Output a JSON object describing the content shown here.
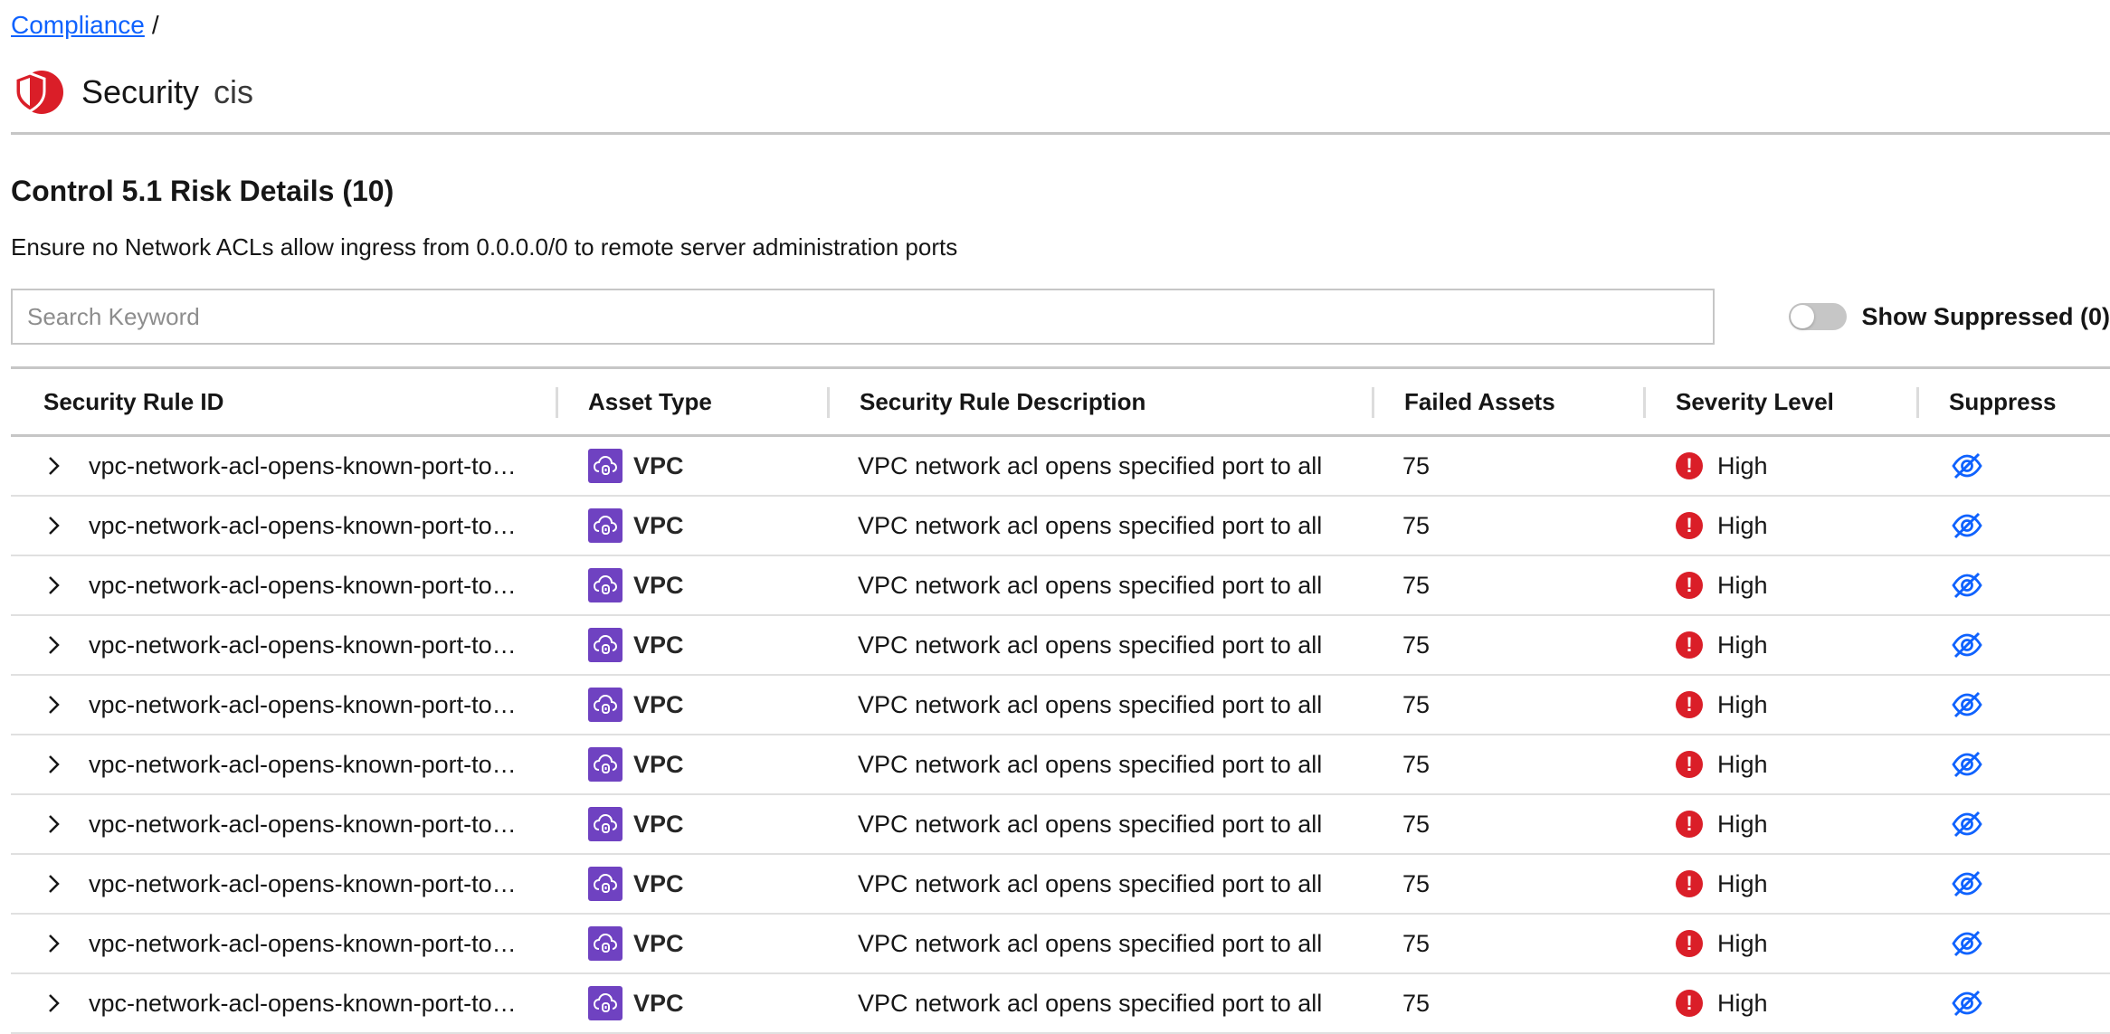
{
  "breadcrumb": {
    "link_label": "Compliance",
    "separator": "/"
  },
  "header": {
    "icon": "shield-icon",
    "title": "Security",
    "subtitle": "cis"
  },
  "section": {
    "title": "Control 5.1 Risk Details (10)",
    "description": "Ensure no Network ACLs allow ingress from 0.0.0.0/0 to remote server administration ports"
  },
  "search": {
    "placeholder": "Search Keyword",
    "value": ""
  },
  "toggle": {
    "label": "Show Suppressed (0)",
    "on": false
  },
  "colors": {
    "link": "#0f62fe",
    "brand_red": "#da1e28",
    "asset_purple": "#6f42c1",
    "suppress_blue": "#0f62fe"
  },
  "table": {
    "columns": [
      "Security Rule ID",
      "Asset Type",
      "Security Rule Description",
      "Failed Assets",
      "Severity Level",
      "Suppress"
    ],
    "rows": [
      {
        "rule_id": "vpc-network-acl-opens-known-port-to…",
        "asset_type": "VPC",
        "description": "VPC network acl opens specified port to all",
        "failed_assets": "75",
        "severity": "High"
      },
      {
        "rule_id": "vpc-network-acl-opens-known-port-to…",
        "asset_type": "VPC",
        "description": "VPC network acl opens specified port to all",
        "failed_assets": "75",
        "severity": "High"
      },
      {
        "rule_id": "vpc-network-acl-opens-known-port-to…",
        "asset_type": "VPC",
        "description": "VPC network acl opens specified port to all",
        "failed_assets": "75",
        "severity": "High"
      },
      {
        "rule_id": "vpc-network-acl-opens-known-port-to…",
        "asset_type": "VPC",
        "description": "VPC network acl opens specified port to all",
        "failed_assets": "75",
        "severity": "High"
      },
      {
        "rule_id": "vpc-network-acl-opens-known-port-to…",
        "asset_type": "VPC",
        "description": "VPC network acl opens specified port to all",
        "failed_assets": "75",
        "severity": "High"
      },
      {
        "rule_id": "vpc-network-acl-opens-known-port-to…",
        "asset_type": "VPC",
        "description": "VPC network acl opens specified port to all",
        "failed_assets": "75",
        "severity": "High"
      },
      {
        "rule_id": "vpc-network-acl-opens-known-port-to…",
        "asset_type": "VPC",
        "description": "VPC network acl opens specified port to all",
        "failed_assets": "75",
        "severity": "High"
      },
      {
        "rule_id": "vpc-network-acl-opens-known-port-to…",
        "asset_type": "VPC",
        "description": "VPC network acl opens specified port to all",
        "failed_assets": "75",
        "severity": "High"
      },
      {
        "rule_id": "vpc-network-acl-opens-known-port-to…",
        "asset_type": "VPC",
        "description": "VPC network acl opens specified port to all",
        "failed_assets": "75",
        "severity": "High"
      },
      {
        "rule_id": "vpc-network-acl-opens-known-port-to…",
        "asset_type": "VPC",
        "description": "VPC network acl opens specified port to all",
        "failed_assets": "75",
        "severity": "High"
      }
    ]
  },
  "icons": {
    "expand": "chevron-right-icon",
    "asset": "vpc-cloud-icon",
    "severity": "error-filled-icon",
    "suppress": "view-off-icon"
  }
}
